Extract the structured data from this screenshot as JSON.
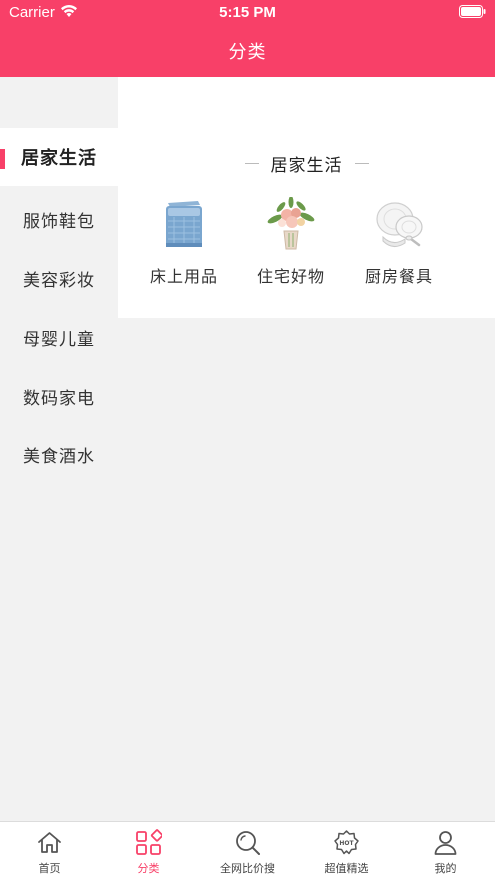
{
  "status_bar": {
    "carrier": "Carrier",
    "time": "5:15 PM"
  },
  "nav": {
    "title": "分类"
  },
  "sidebar": {
    "items": [
      {
        "label": "居家生活",
        "active": true
      },
      {
        "label": "服饰鞋包",
        "active": false
      },
      {
        "label": "美容彩妆",
        "active": false
      },
      {
        "label": "母婴儿童",
        "active": false
      },
      {
        "label": "数码家电",
        "active": false
      },
      {
        "label": "美食酒水",
        "active": false
      }
    ]
  },
  "content": {
    "section_title": "居家生活",
    "categories": [
      {
        "label": "床上用品",
        "icon": "bedding-icon"
      },
      {
        "label": "住宅好物",
        "icon": "flower-vase-icon"
      },
      {
        "label": "厨房餐具",
        "icon": "dishware-icon"
      }
    ]
  },
  "tabbar": {
    "tabs": [
      {
        "label": "首页",
        "icon": "home-icon",
        "active": false
      },
      {
        "label": "分类",
        "icon": "category-grid-icon",
        "active": true
      },
      {
        "label": "全网比价搜",
        "icon": "search-icon",
        "active": false
      },
      {
        "label": "超值精选",
        "icon": "hot-badge-icon",
        "active": false
      },
      {
        "label": "我的",
        "icon": "profile-icon",
        "active": false
      }
    ]
  },
  "colors": {
    "accent": "#f84068",
    "sidebar_bg": "#f2f2f2",
    "panel_bg": "#ffffff"
  }
}
